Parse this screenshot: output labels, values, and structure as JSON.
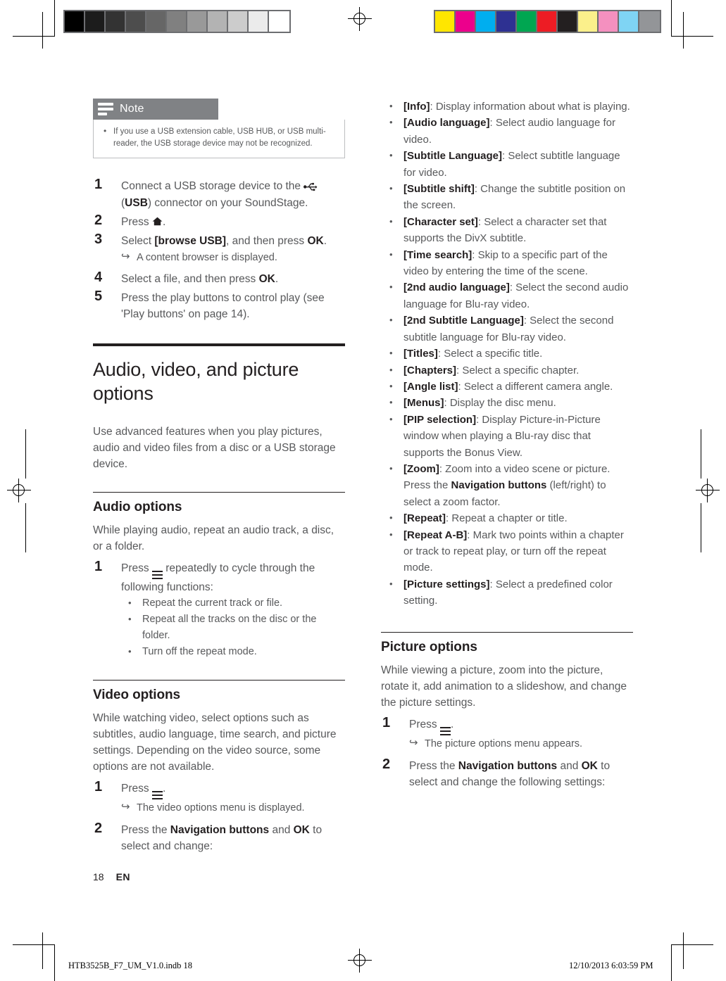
{
  "print_marks": {
    "gray_bar": {
      "name": "grayscale-calibration-bar",
      "swatches": [
        "#000000",
        "#1c1c1c",
        "#333333",
        "#4d4d4d",
        "#666666",
        "#808080",
        "#999999",
        "#b3b3b3",
        "#cccccc",
        "#ebebeb",
        "#ffffff"
      ]
    },
    "color_bar": {
      "name": "color-calibration-bar",
      "swatches": [
        "#ffe600",
        "#ec008c",
        "#00aeef",
        "#2e3192",
        "#00a651",
        "#ed1c24",
        "#231f20",
        "#fbf08b",
        "#f490bf",
        "#7fd4f4",
        "#939598"
      ]
    }
  },
  "note": {
    "title": "Note",
    "items": [
      "If you use a USB extension cable, USB HUB, or USB multi-reader, the USB storage device may not be recognized."
    ]
  },
  "usb_steps": [
    {
      "num": "1",
      "html": "Connect a USB storage device to the <span class=\"icon-inline\" data-name=\"usb-icon\" data-interactable=\"false\">&#8942;</span> (<b>USB</b>) connector on your SoundStage."
    },
    {
      "num": "2",
      "html": "Press <span data-name=\"home-icon\" data-interactable=\"false\">&#8962;</span>."
    },
    {
      "num": "3",
      "html": "Select <b>[browse USB]</b>, and then press <b>OK</b>.",
      "arrow": "A content browser is displayed."
    },
    {
      "num": "4",
      "html": "Select a file, and then press <b>OK</b>."
    },
    {
      "num": "5",
      "html": "Press the play buttons to control play (see 'Play buttons' on page 14)."
    }
  ],
  "section_main": {
    "heading": "Audio, video, and picture options",
    "intro": "Use advanced features when you play pictures, audio and video files from a disc or a USB storage device."
  },
  "audio_options": {
    "heading": "Audio options",
    "intro": "While playing audio, repeat an audio track, a disc, or a folder.",
    "step_num": "1",
    "step_html": "Press <span class=\"ico-hamburger\" data-name=\"options-menu-icon\" data-interactable=\"false\"><i></i><i></i><i></i></span> repeatedly to cycle through the following functions:",
    "bullets": [
      "Repeat the current track or file.",
      "Repeat all the tracks on the disc or the folder.",
      "Turn off the repeat mode."
    ]
  },
  "video_options": {
    "heading": "Video options",
    "intro": "While watching video, select options such as subtitles, audio language, time search, and picture settings. Depending on the video source, some options are not available.",
    "step1_num": "1",
    "step1_html": "Press <span class=\"ico-hamburger\" data-name=\"options-menu-icon\" data-interactable=\"false\"><i></i><i></i><i></i></span>.",
    "step1_arrow": "The video options menu is displayed.",
    "step2_num": "2",
    "step2_html": "Press the <b>Navigation buttons</b> and <b>OK</b> to select and change:"
  },
  "video_option_items": [
    {
      "term": "[Info]",
      "desc": ": Display information about what is playing."
    },
    {
      "term": "[Audio language]",
      "desc": ": Select audio language for video."
    },
    {
      "term": "[Subtitle Language]",
      "desc": ": Select subtitle language for video."
    },
    {
      "term": "[Subtitle shift]",
      "desc": ": Change the subtitle position on the screen."
    },
    {
      "term": "[Character set]",
      "desc": ": Select a character set that supports the DivX subtitle."
    },
    {
      "term": "[Time search]",
      "desc": ": Skip to a specific part of the video by entering the time of the scene."
    },
    {
      "term": "[2nd audio language]",
      "desc": ": Select the second audio language for Blu-ray video."
    },
    {
      "term": "[2nd Subtitle Language]",
      "desc": ": Select the second subtitle language for Blu-ray video."
    },
    {
      "term": "[Titles]",
      "desc": ": Select a specific title."
    },
    {
      "term": "[Chapters]",
      "desc": ": Select a specific chapter."
    },
    {
      "term": "[Angle list]",
      "desc": ": Select a different camera angle."
    },
    {
      "term": "[Menus]",
      "desc": ": Display the disc menu."
    },
    {
      "term": "[PIP selection]",
      "desc": ": Display Picture-in-Picture window when playing a Blu-ray disc that supports the Bonus View."
    },
    {
      "term": "[Zoom]",
      "desc": ": Zoom into a video scene or picture. Press the <b>Navigation buttons</b> (left/right) to select a zoom factor.",
      "html": true
    },
    {
      "term": "[Repeat]",
      "desc": ": Repeat a chapter or title."
    },
    {
      "term": "[Repeat A-B]",
      "desc": ": Mark two points within a chapter or track to repeat play, or turn off the repeat mode."
    },
    {
      "term": "[Picture settings]",
      "desc": ": Select a predefined color setting."
    }
  ],
  "picture_options": {
    "heading": "Picture options",
    "intro": "While viewing a picture, zoom into the picture, rotate it, add animation to a slideshow, and change the picture settings.",
    "step1_num": "1",
    "step1_html": "Press <span class=\"ico-hamburger\" data-name=\"options-menu-icon\" data-interactable=\"false\"><i></i><i></i><i></i></span>.",
    "step1_arrow": "The picture options menu appears.",
    "step2_num": "2",
    "step2_html": "Press the <b>Navigation buttons</b> and <b>OK</b> to select and change the following settings:"
  },
  "footer": {
    "page_number": "18",
    "language": "EN",
    "print_file": "HTB3525B_F7_UM_V1.0.indb   18",
    "print_date": "12/10/2013   6:03:59 PM"
  }
}
